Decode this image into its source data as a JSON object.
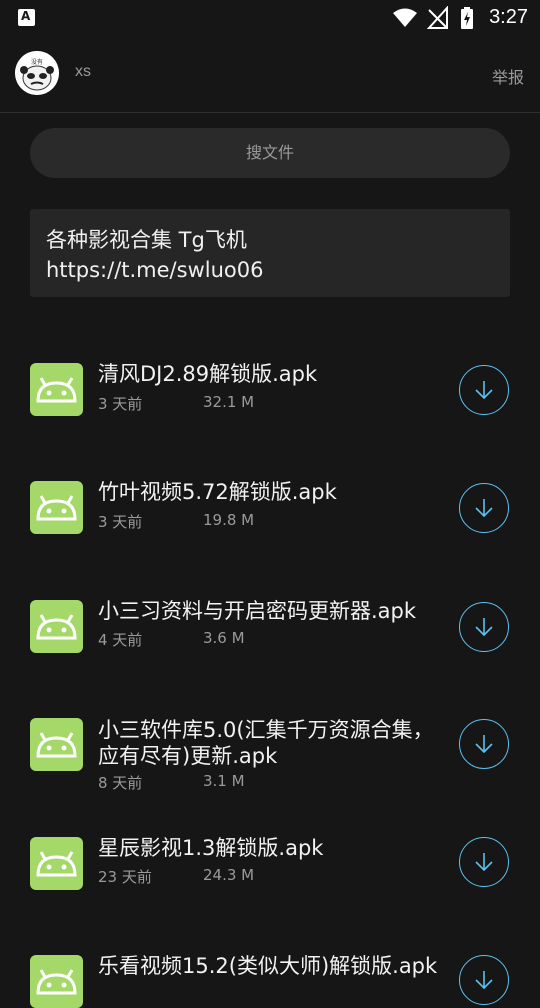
{
  "status_bar": {
    "left_icon": "A",
    "time": "3:27",
    "icons": [
      "wifi-icon",
      "no-signal-icon",
      "battery-charging-icon"
    ]
  },
  "header": {
    "username": "xs",
    "report_label": "举报",
    "avatar_icon": "panda-meme-avatar",
    "avatar_text": "没有"
  },
  "search": {
    "label": "搜文件"
  },
  "notice": {
    "lines": [
      "各种影视合集 Tg飞机",
      "https://t.me/swluo06"
    ]
  },
  "files": [
    {
      "name": "清风DJ2.89解锁版.apk",
      "age": "3 天前",
      "size": "32.1 M"
    },
    {
      "name": "竹叶视频5.72解锁版.apk",
      "age": "3 天前",
      "size": "19.8 M"
    },
    {
      "name": "小三习资料与开启密码更新器.apk",
      "age": "4 天前",
      "size": "3.6 M"
    },
    {
      "name": "小三软件库5.0(汇集千万资源合集，应有尽有)更新.apk",
      "age": "8 天前",
      "size": "3.1 M"
    },
    {
      "name": "星辰影视1.3解锁版.apk",
      "age": "23 天前",
      "size": "24.3 M"
    },
    {
      "name": "乐看视频15.2(类似大师)解锁版.apk",
      "age": "",
      "size": ""
    }
  ],
  "colors": {
    "background": "#161616",
    "android_icon": "#a4d868",
    "download_accent": "#5cc1ee"
  }
}
